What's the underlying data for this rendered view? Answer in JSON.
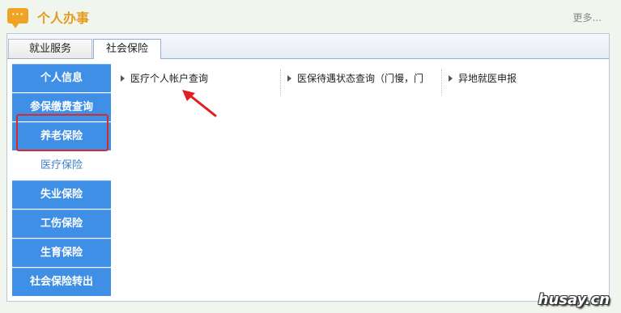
{
  "header": {
    "icon": "chat-bubble-icon",
    "icon_glyph": "···",
    "title": "个人办事",
    "more_label": "更多..."
  },
  "tabs": [
    {
      "label": "就业服务",
      "active": false
    },
    {
      "label": "社会保险",
      "active": true
    }
  ],
  "sidebar": {
    "items": [
      {
        "label": "个人信息",
        "active": false
      },
      {
        "label": "参保缴费查询",
        "active": false
      },
      {
        "label": "养老保险",
        "active": false
      },
      {
        "label": "医疗保险",
        "active": true
      },
      {
        "label": "失业保险",
        "active": false
      },
      {
        "label": "工伤保险",
        "active": false
      },
      {
        "label": "生育保险",
        "active": false
      },
      {
        "label": "社会保险转出",
        "active": false
      }
    ]
  },
  "links": [
    {
      "label": "医疗个人帐户查询"
    },
    {
      "label": "医保待遇状态查询（门慢，门"
    },
    {
      "label": "异地就医申报"
    }
  ],
  "watermark": "husay.cn",
  "colors": {
    "accent_orange": "#e59a1e",
    "sidebar_blue": "#3f8fe6",
    "highlight_red": "#d92a2a"
  }
}
